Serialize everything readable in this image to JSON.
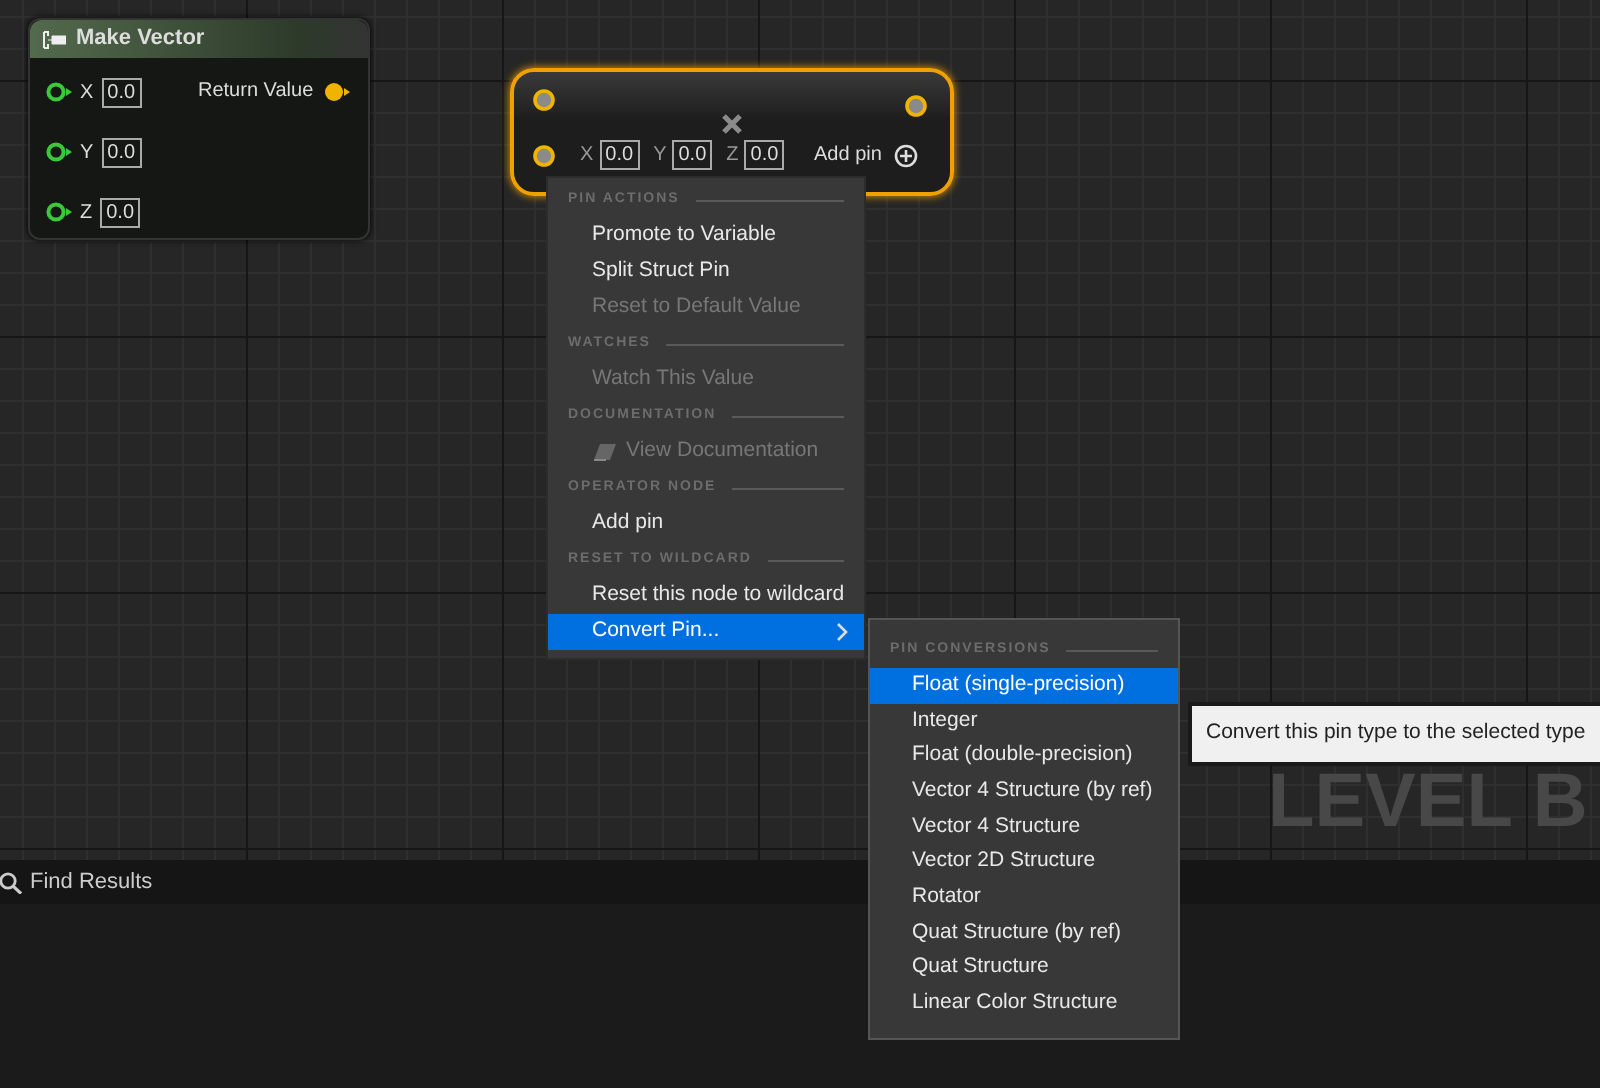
{
  "graph": {
    "corner_label": "LEVEL B"
  },
  "make_vector_node": {
    "title": "Make Vector",
    "inputs": [
      {
        "label": "X",
        "value": "0.0"
      },
      {
        "label": "Y",
        "value": "0.0"
      },
      {
        "label": "Z",
        "value": "0.0"
      }
    ],
    "output": {
      "label": "Return Value",
      "connected": true
    }
  },
  "operator_node": {
    "inputs": [
      {
        "label": "X",
        "value": "0.0"
      },
      {
        "label": "Y",
        "value": "0.0"
      },
      {
        "label": "Z",
        "value": "0.0"
      }
    ],
    "add_pin_label": "Add pin"
  },
  "context_menu": {
    "sections": [
      {
        "heading": "PIN ACTIONS",
        "items": [
          {
            "label": "Promote to Variable",
            "kind": "plain",
            "disabled": false,
            "selected": false
          },
          {
            "label": "Split Struct Pin",
            "kind": "plain",
            "disabled": false,
            "selected": false
          },
          {
            "label": "Reset to Default Value",
            "kind": "plain",
            "disabled": true,
            "selected": false
          }
        ]
      },
      {
        "heading": "WATCHES",
        "items": [
          {
            "label": "Watch This Value",
            "kind": "plain",
            "disabled": true,
            "selected": false
          }
        ]
      },
      {
        "heading": "DOCUMENTATION",
        "items": [
          {
            "label": "View Documentation",
            "kind": "doc",
            "disabled": true,
            "selected": false
          }
        ]
      },
      {
        "heading": "OPERATOR NODE",
        "items": [
          {
            "label": "Add pin",
            "kind": "plain",
            "disabled": false,
            "selected": false
          }
        ]
      },
      {
        "heading": "RESET TO WILDCARD",
        "items": [
          {
            "label": "Reset this node to wildcard",
            "kind": "plain",
            "disabled": false,
            "selected": false
          },
          {
            "label": "Convert Pin...",
            "kind": "submenu",
            "disabled": false,
            "selected": true
          }
        ]
      }
    ]
  },
  "submenu": {
    "heading": "PIN CONVERSIONS",
    "items": [
      {
        "label": "Float (single-precision)",
        "selected": true
      },
      {
        "label": "Integer",
        "selected": false
      },
      {
        "label": "Float (double-precision)",
        "selected": false
      },
      {
        "label": "Vector 4 Structure (by ref)",
        "selected": false
      },
      {
        "label": "Vector 4 Structure",
        "selected": false
      },
      {
        "label": "Vector 2D Structure",
        "selected": false
      },
      {
        "label": "Rotator",
        "selected": false
      },
      {
        "label": "Quat Structure (by ref)",
        "selected": false
      },
      {
        "label": "Quat Structure",
        "selected": false
      },
      {
        "label": "Linear Color Structure",
        "selected": false
      }
    ]
  },
  "tooltip": {
    "text": "Convert this pin type to the selected type"
  },
  "bottom_panel": {
    "tab": "Find Results"
  }
}
